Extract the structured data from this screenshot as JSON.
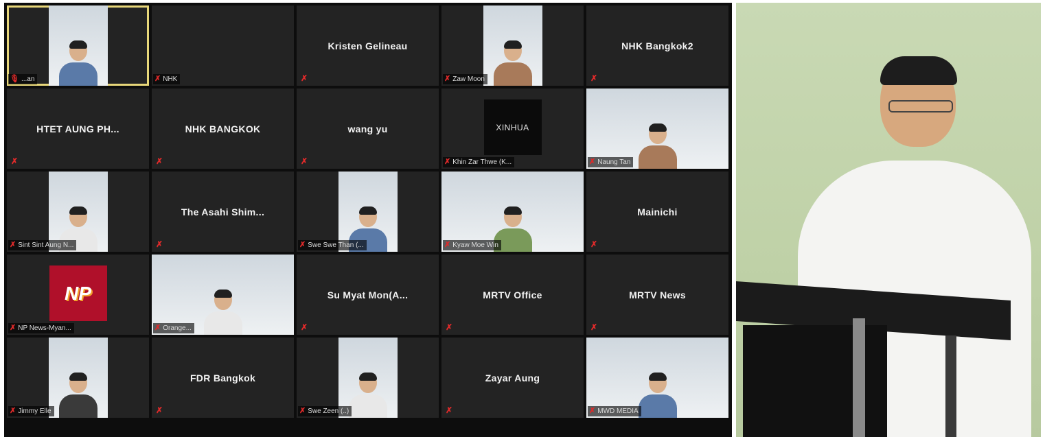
{
  "meeting": {
    "tiles": [
      {
        "label": "...an",
        "type": "video",
        "active": true
      },
      {
        "label": "NHK",
        "type": "blank"
      },
      {
        "name": "Kristen Gelineau",
        "type": "name"
      },
      {
        "label": "Zaw Moon",
        "type": "video"
      },
      {
        "name": "NHK Bangkok2",
        "type": "name"
      },
      {
        "name": "HTET AUNG PH...",
        "type": "name"
      },
      {
        "name": "NHK BANGKOK",
        "type": "name"
      },
      {
        "name": "wang yu",
        "type": "name"
      },
      {
        "label": "Khin Zar Thwe (K...",
        "type": "xinhua",
        "logo": "XINHUA"
      },
      {
        "label": "Naung Tan",
        "type": "video-wide"
      },
      {
        "label": "Sint Sint Aung N...",
        "type": "video"
      },
      {
        "name": "The Asahi Shim...",
        "type": "name"
      },
      {
        "label": "Swe Swe Than (...",
        "type": "video"
      },
      {
        "label": "Kyaw Moe Win",
        "type": "video-wide"
      },
      {
        "name": "Mainichi",
        "type": "name"
      },
      {
        "label": "NP News-Myan...",
        "type": "logo",
        "logo": "NP"
      },
      {
        "label": "Orange...",
        "type": "video-wide"
      },
      {
        "name": "Su Myat Mon(A...",
        "type": "name"
      },
      {
        "name": "MRTV Office",
        "type": "name"
      },
      {
        "name": "MRTV News",
        "type": "name"
      },
      {
        "label": "Jimmy Elle",
        "type": "video"
      },
      {
        "name": "FDR Bangkok",
        "type": "name"
      },
      {
        "label": "Swe Zeen (..)",
        "type": "video"
      },
      {
        "name": "Zayar Aung",
        "type": "name"
      },
      {
        "label": "MWD MEDIA",
        "type": "video-wide"
      }
    ]
  },
  "icons": {
    "muted_mic": "muted-microphone-icon",
    "active_mic": "microphone-icon"
  },
  "colors": {
    "tile_bg": "#232323",
    "active_border": "#e8d77a",
    "muted_red": "#e02a2a"
  }
}
